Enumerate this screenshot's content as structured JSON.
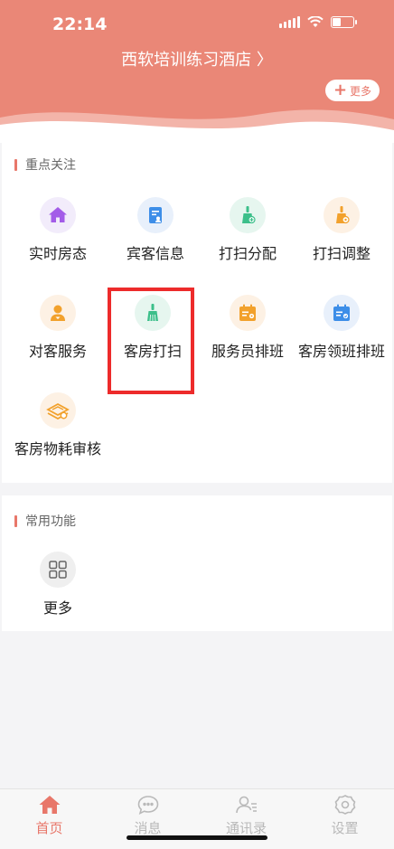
{
  "status_bar": {
    "time": "22:14"
  },
  "header": {
    "hotel_name": "西软培训练习酒店 〉",
    "more_button": "更多"
  },
  "focus_section": {
    "title": "重点关注",
    "items": [
      {
        "label": "实时房态",
        "icon": "house-icon"
      },
      {
        "label": "宾客信息",
        "icon": "guest-document-icon"
      },
      {
        "label": "打扫分配",
        "icon": "broom-assign-icon"
      },
      {
        "label": "打扫调整",
        "icon": "broom-adjust-icon"
      },
      {
        "label": "对客服务",
        "icon": "guest-service-icon"
      },
      {
        "label": "客房打扫",
        "icon": "broom-icon"
      },
      {
        "label": "服务员排班",
        "icon": "schedule-icon"
      },
      {
        "label": "客房领班排班",
        "icon": "supervisor-schedule-icon"
      },
      {
        "label": "客房物耗审核",
        "icon": "supplies-audit-icon"
      }
    ]
  },
  "common_section": {
    "title": "常用功能",
    "items": [
      {
        "label": "更多",
        "icon": "grid-icon"
      }
    ]
  },
  "tabbar": {
    "tabs": [
      {
        "label": "首页",
        "icon": "home-icon",
        "active": true
      },
      {
        "label": "消息",
        "icon": "message-icon",
        "active": false
      },
      {
        "label": "通讯录",
        "icon": "contacts-icon",
        "active": false
      },
      {
        "label": "设置",
        "icon": "gear-icon",
        "active": false
      }
    ]
  },
  "colors": {
    "accent": "#e8776a",
    "header": "#ea8777",
    "highlight": "#ed2b2b"
  }
}
